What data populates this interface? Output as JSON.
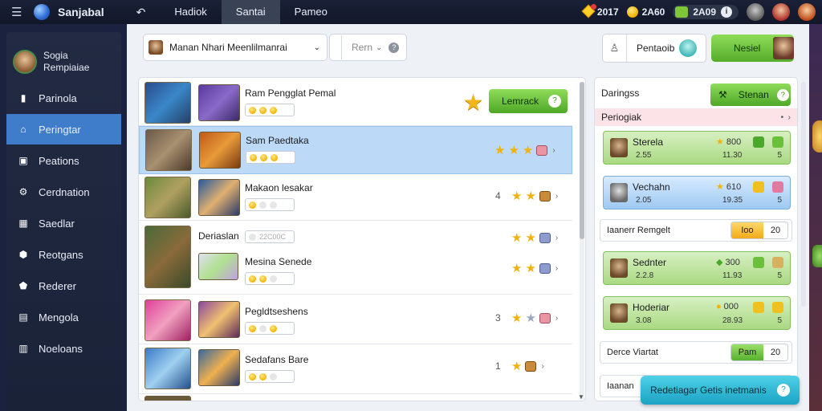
{
  "topbar": {
    "title": "Sanjabal",
    "tabs": [
      {
        "label": "Hadiok",
        "active": false
      },
      {
        "label": "Santai",
        "active": true
      },
      {
        "label": "Pameo",
        "active": false
      }
    ],
    "currencies": [
      {
        "icon": "gem-icon",
        "value": "2017"
      },
      {
        "icon": "coin-icon",
        "value": "2A60"
      },
      {
        "icon": "energy-icon",
        "value": "2A09"
      }
    ]
  },
  "sidebar": {
    "profile_name": "Sogia",
    "profile_sub": "Rempiaiae",
    "items": [
      {
        "label": "Parinola",
        "icon": "star-icon",
        "active": false
      },
      {
        "label": "Peringtar",
        "icon": "home-icon",
        "active": true
      },
      {
        "label": "Peations",
        "icon": "list-icon",
        "active": false
      },
      {
        "label": "Cerdnation",
        "icon": "settings-icon",
        "active": false
      },
      {
        "label": "Saedlar",
        "icon": "grid-icon",
        "active": false
      },
      {
        "label": "Reotgans",
        "icon": "shield-icon",
        "active": false
      },
      {
        "label": "Rederer",
        "icon": "pin-icon",
        "active": false
      },
      {
        "label": "Mengola",
        "icon": "chart-icon",
        "active": false
      },
      {
        "label": "Noeloans",
        "icon": "doc-icon",
        "active": false
      }
    ]
  },
  "header": {
    "search_value": "Manan Nhari Meenlilmanrai",
    "filter_placeholder": "Rern",
    "partner_label": "Pentaoib",
    "next_label": "Nesiel"
  },
  "list": {
    "rows": [
      {
        "title": "Ram Pengglat Pemal",
        "num": "",
        "stars": 1,
        "chest": "",
        "selected": false,
        "action": "Lemrack"
      },
      {
        "title": "Sam Paedtaka",
        "num": "",
        "stars": 3,
        "chest": "face",
        "selected": true,
        "action": ""
      },
      {
        "title": "Makaon lesakar",
        "num": "4",
        "stars": 2,
        "chest": "brown",
        "selected": false,
        "action": ""
      },
      {
        "title": "Deriaslan",
        "num": "",
        "stars": 1,
        "chest": "blue",
        "selected": false,
        "action": ""
      },
      {
        "title": "Mesina Senede",
        "num": "",
        "stars": 2,
        "chest": "blue",
        "selected": false,
        "action": ""
      },
      {
        "title": "Pegldtseshens",
        "num": "3",
        "stars": 2,
        "chest": "pink",
        "selected": false,
        "action": ""
      },
      {
        "title": "Sedafans Bare",
        "num": "1",
        "stars": 2,
        "chest": "brown",
        "selected": false,
        "action": ""
      }
    ],
    "pill_label": "22C00C"
  },
  "right": {
    "header": "Daringss",
    "header_btn": "Stenan",
    "sub": "Periogiak",
    "cards": [
      {
        "title": "Sterela",
        "sub": "2.55",
        "badge": "800",
        "num": "11.30",
        "end": "5",
        "color": "green"
      },
      {
        "title": "Vechahn",
        "sub": "2.05",
        "badge": "610",
        "num": "19.35",
        "end": "5",
        "color": "blue"
      },
      {
        "title": "Sednter",
        "sub": "2.2.8",
        "badge": "300",
        "num": "11.93",
        "end": "5",
        "color": "green"
      },
      {
        "title": "Hoderiar",
        "sub": "3.08",
        "badge": "000",
        "num": "28.93",
        "end": "5",
        "color": "green"
      }
    ],
    "rows": [
      {
        "label": "Iaanerr Remgelt",
        "on": "Ioo",
        "off": "20",
        "style": "orange"
      },
      {
        "label": "Derce Viartat",
        "on": "Pam",
        "off": "20",
        "style": "green"
      },
      {
        "label": "Iaanan",
        "on": "",
        "off": "",
        "style": "none"
      }
    ]
  },
  "toast": {
    "text": "Redetiagar Getis inetmanis"
  }
}
